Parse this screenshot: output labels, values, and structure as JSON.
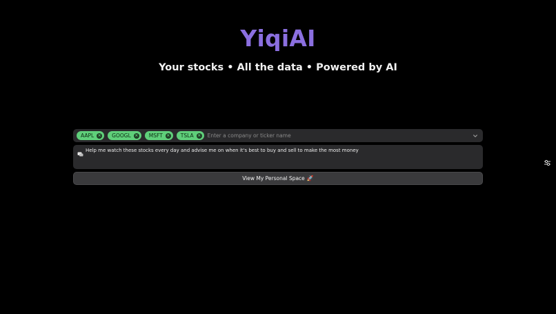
{
  "app": {
    "brand": "YiqiAI",
    "tagline": "Your stocks • All the data • Powered by AI"
  },
  "tickers": {
    "chips": [
      {
        "symbol": "AAPL"
      },
      {
        "symbol": "GOOGL"
      },
      {
        "symbol": "MSFT"
      },
      {
        "symbol": "TSLA"
      }
    ],
    "placeholder": "Enter a company or ticker name",
    "chip_color": "#5fcf7a"
  },
  "prompt": {
    "value": "Help me watch these stocks every day and advise me on when it's best to buy and sell to make the most money"
  },
  "cta": {
    "label": "View My Personal Space",
    "emoji": "🚀"
  },
  "icons": {
    "chip_remove": "close-icon",
    "dropdown": "chevron-down-icon",
    "prompt": "chat-bubble-icon",
    "side_tool": "settings-sliders-icon"
  },
  "colors": {
    "background": "#000000",
    "brand": "#8b6fe0",
    "surface": "#2a2a2c"
  }
}
